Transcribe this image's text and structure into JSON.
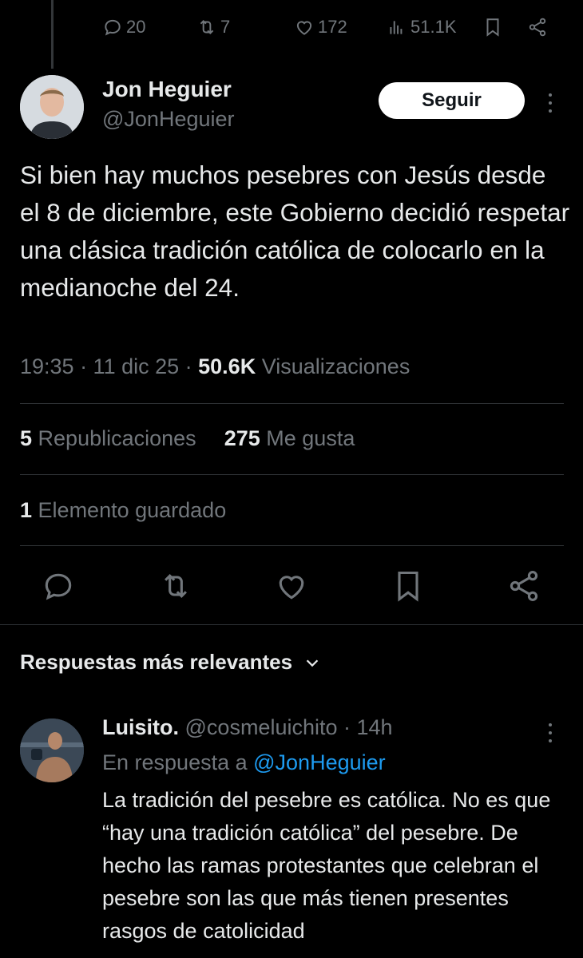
{
  "prev_tweet_actions": {
    "replies": "20",
    "reposts": "7",
    "likes": "172",
    "views": "51.1K"
  },
  "author": {
    "name": "Jon Heguier",
    "handle": "@JonHeguier"
  },
  "follow_button": {
    "label": "Seguir"
  },
  "tweet": {
    "text": "Si bien hay muchos pesebres con Jesús desde el 8 de diciembre, este Gobierno decidió respetar una clásica tradición católica de colocarlo en la medianoche del 24.",
    "time": "19:35 · 11 dic 25 · ",
    "views_count": "50.6K",
    "views_label": " Visualizaciones"
  },
  "stats": {
    "reposts_count": "5",
    "reposts_label": "Republicaciones",
    "likes_count": "275",
    "likes_label": "Me gusta",
    "saved_count": "1",
    "saved_label": "Elemento guardado"
  },
  "replies_section": {
    "title": "Respuestas más relevantes"
  },
  "reply": {
    "name": "Luisito.",
    "handle": "@cosmeluichito",
    "time": "14h",
    "in_reply_prefix": "En respuesta a ",
    "in_reply_mention": "@JonHeguier",
    "text": "La tradición del pesebre es católica. No es que “hay una tradición católica” del pesebre. De hecho las ramas protestantes que celebran el pesebre son las que más tienen presentes rasgos de catolicidad"
  },
  "colors": {
    "background": "#000000",
    "text": "#e7e9ea",
    "muted": "#71767b",
    "link": "#1d9bf0",
    "divider": "#2f3336"
  }
}
